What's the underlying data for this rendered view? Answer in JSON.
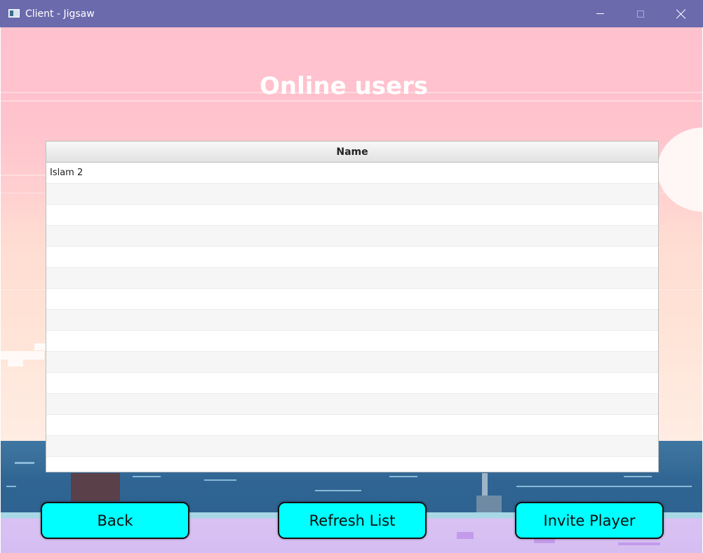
{
  "window": {
    "title": "Client - Jigsaw",
    "icon": "app-window-icon",
    "controls": [
      "minimize",
      "maximize",
      "close"
    ]
  },
  "heading": "Online users",
  "table": {
    "columns": [
      "Name"
    ],
    "rows": [
      "Islam 2",
      "",
      "",
      "",
      "",
      "",
      "",
      "",
      "",
      "",
      "",
      "",
      "",
      "",
      ""
    ]
  },
  "buttons": {
    "back": "Back",
    "refresh": "Refresh List",
    "invite": "Invite Player"
  },
  "colors": {
    "titlebar": "#6b6aad",
    "button_fill": "#00ffff",
    "sky": "#ffc1ce",
    "sea": "#2f6493"
  }
}
